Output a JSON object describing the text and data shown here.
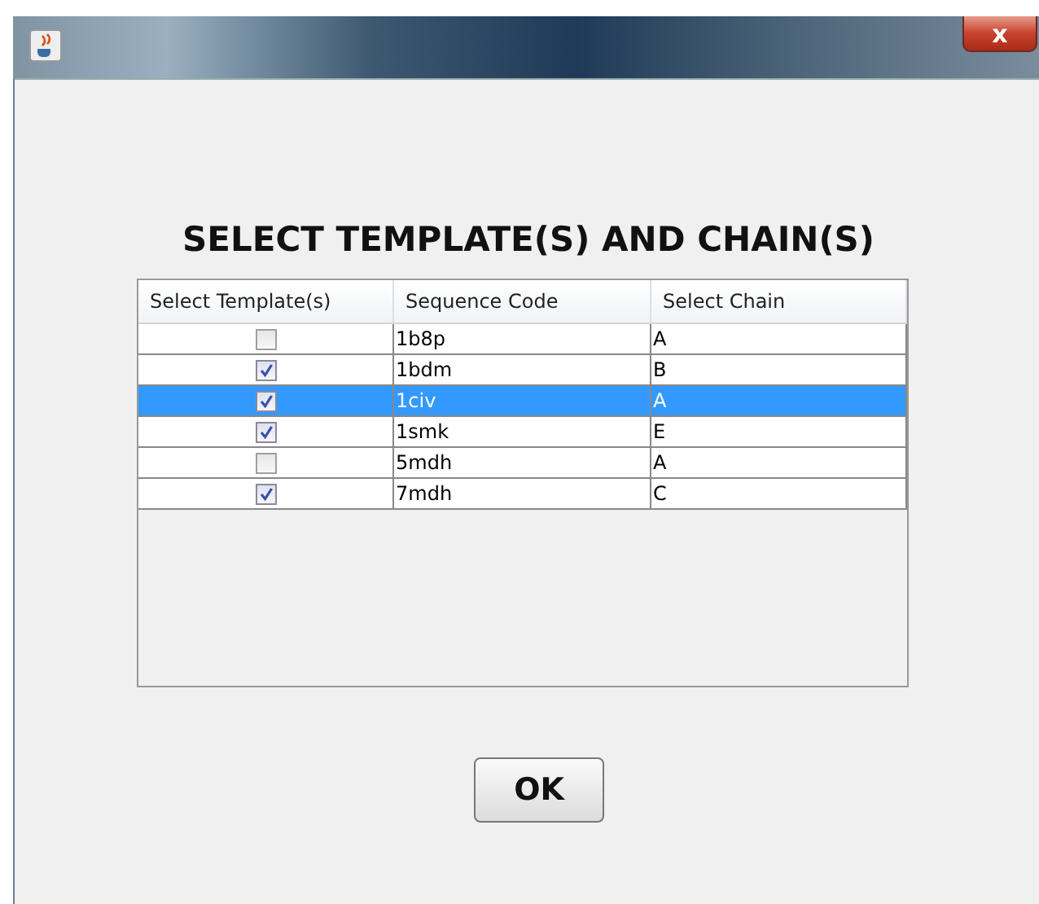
{
  "window": {
    "close": "x"
  },
  "heading": "SELECT TEMPLATE(S) AND CHAIN(S)",
  "table": {
    "columns": [
      "Select Template(s)",
      "Sequence Code",
      "Select Chain"
    ],
    "rows": [
      {
        "checked": false,
        "code": "1b8p",
        "chain": "A",
        "selected": false
      },
      {
        "checked": true,
        "code": "1bdm",
        "chain": "B",
        "selected": false
      },
      {
        "checked": true,
        "code": "1civ",
        "chain": "A",
        "selected": true
      },
      {
        "checked": true,
        "code": "1smk",
        "chain": "E",
        "selected": false
      },
      {
        "checked": false,
        "code": "5mdh",
        "chain": "A",
        "selected": false
      },
      {
        "checked": true,
        "code": "7mdh",
        "chain": "C",
        "selected": false
      }
    ]
  },
  "buttons": [
    "OK"
  ]
}
